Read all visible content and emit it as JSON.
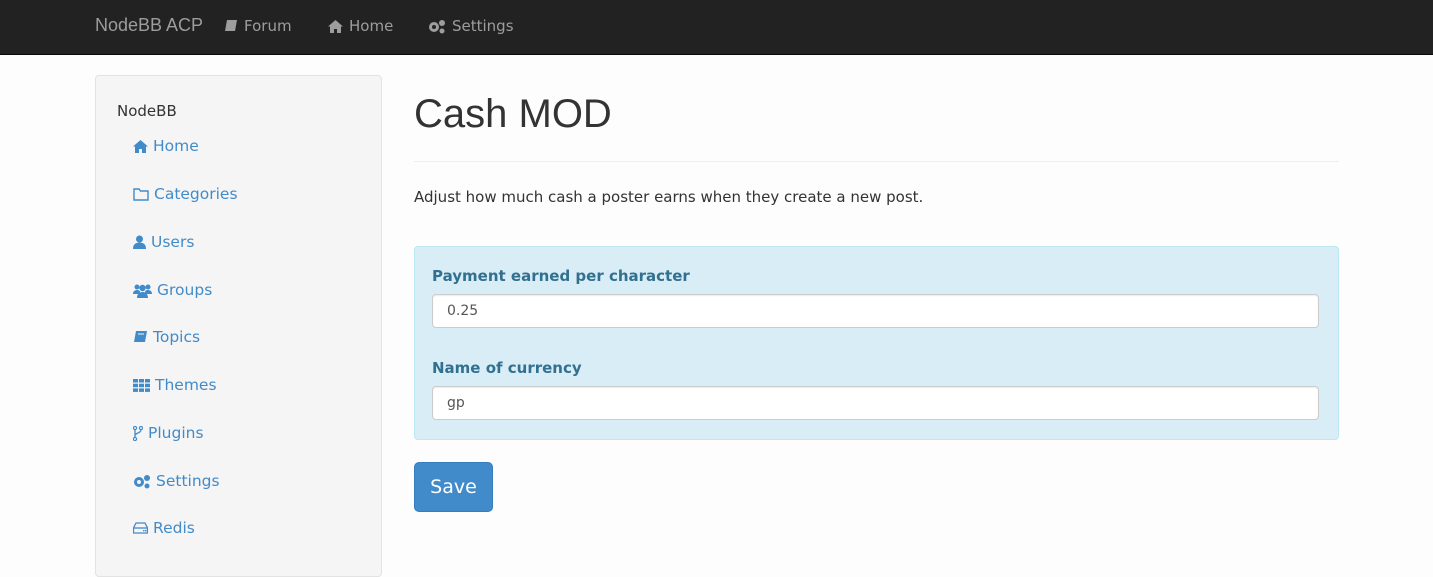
{
  "navbar": {
    "brand": "NodeBB ACP",
    "links": [
      {
        "label": "Forum",
        "icon": "book-icon"
      },
      {
        "label": "Home",
        "icon": "home-icon"
      },
      {
        "label": "Settings",
        "icon": "cogs-icon"
      }
    ]
  },
  "sidebar": {
    "title": "NodeBB",
    "items": [
      {
        "label": "Home",
        "icon": "home-icon"
      },
      {
        "label": "Categories",
        "icon": "folder-icon"
      },
      {
        "label": "Users",
        "icon": "user-icon"
      },
      {
        "label": "Groups",
        "icon": "group-icon"
      },
      {
        "label": "Topics",
        "icon": "book-icon"
      },
      {
        "label": "Themes",
        "icon": "grid-icon"
      },
      {
        "label": "Plugins",
        "icon": "code-fork-icon"
      },
      {
        "label": "Settings",
        "icon": "cogs-icon"
      },
      {
        "label": "Redis",
        "icon": "hdd-icon"
      }
    ]
  },
  "main": {
    "title": "Cash MOD",
    "description": "Adjust how much cash a poster earns when they create a new post.",
    "form": {
      "payment_label": "Payment earned per character",
      "payment_value": "0.25",
      "currency_label": "Name of currency",
      "currency_value": "gp"
    },
    "save_label": "Save"
  },
  "colors": {
    "accent": "#428bca",
    "panel_bg": "#d9edf7",
    "panel_text": "#31708f",
    "navbar_bg": "#222222"
  }
}
